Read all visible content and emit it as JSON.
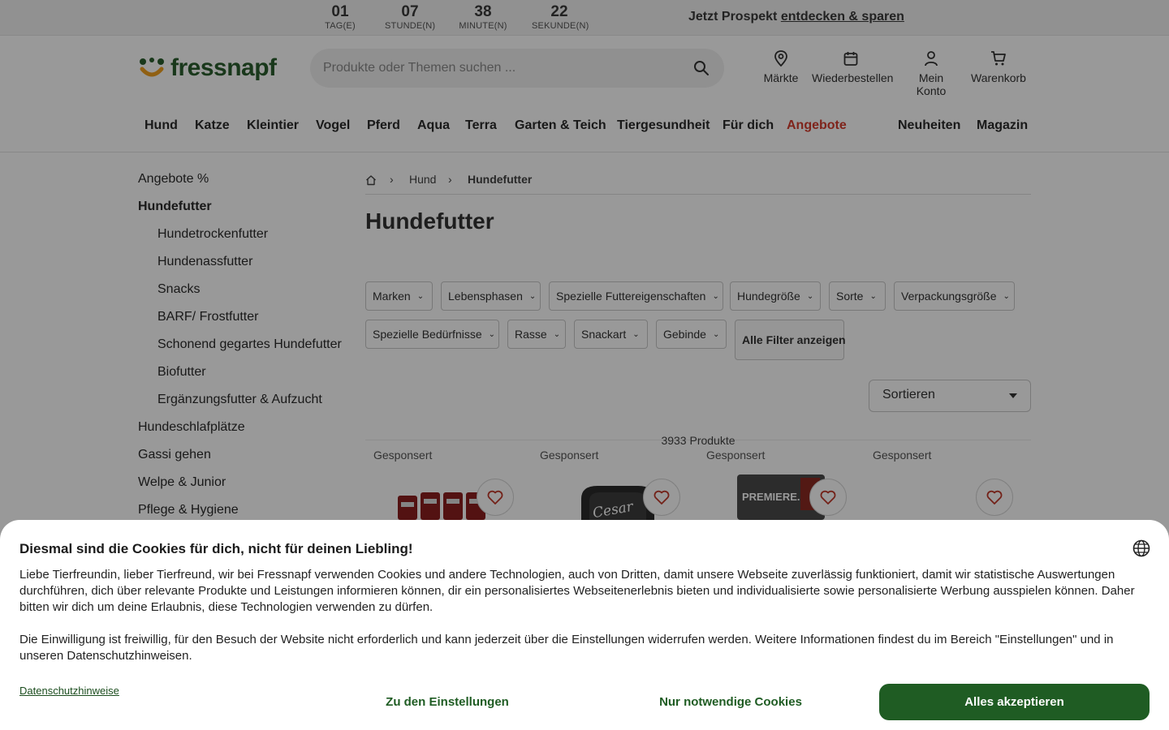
{
  "countdown": [
    {
      "value": "01",
      "label": "TAG(E)"
    },
    {
      "value": "07",
      "label": "STUNDE(N)"
    },
    {
      "value": "38",
      "label": "MINUTE(N)"
    },
    {
      "value": "22",
      "label": "SEKUNDE(N)"
    }
  ],
  "promo": {
    "text": "Jetzt Prospekt",
    "link": "entdecken & sparen"
  },
  "header": {
    "logo": "fressnapf",
    "search_placeholder": "Produkte oder Themen suchen ...",
    "icons": [
      {
        "label": "Märkte",
        "icon": "location-pin-icon"
      },
      {
        "label": "Wiederbestellen",
        "icon": "calendar-icon"
      },
      {
        "label": "Mein Konto",
        "icon": "user-icon"
      },
      {
        "label": "Warenkorb",
        "icon": "cart-icon"
      }
    ]
  },
  "nav": {
    "items": [
      "Hund",
      "Katze",
      "Kleintier",
      "Vogel",
      "Pferd",
      "Aqua",
      "Terra",
      "Garten & Teich",
      "Tiergesundheit",
      "Für dich",
      "Angebote"
    ],
    "right": [
      "Neuheiten",
      "Magazin"
    ],
    "sale_color": "#d43c2d"
  },
  "sidebar": {
    "items": [
      {
        "label": "Angebote %"
      },
      {
        "label": "Hundefutter"
      },
      {
        "label": "Hundetrockenfutter"
      },
      {
        "label": "Hundenassfutter"
      },
      {
        "label": "Snacks"
      },
      {
        "label": "BARF/ Frostfutter"
      },
      {
        "label": "Schonend gegartes Hundefutter"
      },
      {
        "label": "Biofutter"
      },
      {
        "label": "Ergänzungsfutter & Aufzucht"
      },
      {
        "label": "Hundeschlafplätze"
      },
      {
        "label": "Gassi gehen"
      },
      {
        "label": "Welpe & Junior"
      },
      {
        "label": "Pflege & Hygiene"
      }
    ]
  },
  "breadcrumb": [
    "Hund",
    "Hundefutter"
  ],
  "page_title": "Hundefutter",
  "filters": {
    "row1": [
      "Marken",
      "Lebensphasen",
      "Spezielle Futtereigenschaften",
      "Hundegröße",
      "Sorte",
      "Verpackungsgröße"
    ],
    "row2": [
      "Spezielle Bedürfnisse",
      "Rasse",
      "Snackart",
      "Gebinde"
    ],
    "all": "Alle Filter anzeigen"
  },
  "sort_label": "Sortieren",
  "product_count": "3933 Produkte",
  "products": [
    {
      "tag": "Gesponsert"
    },
    {
      "tag": "Gesponsert",
      "brand": "Cesar"
    },
    {
      "tag": "Gesponsert",
      "brand": "PREMIERE."
    },
    {
      "tag": "Gesponsert"
    }
  ],
  "cookie": {
    "title": "Diesmal sind die Cookies für dich, nicht für deinen Liebling!",
    "p1": "Liebe Tierfreundin, lieber Tierfreund, wir bei Fressnapf verwenden Cookies und andere Technologien, auch von Dritten, damit unsere Webseite zuverlässig funktioniert, damit wir statistische Auswertungen durchführen, dich über relevante Produkte und Leistungen informieren können, dir ein personalisiertes Webseitenerlebnis bieten und individualisierte sowie personalisierte Werbung ausspielen können. Daher bitten wir dich um deine Erlaubnis, diese Technologien verwenden zu dürfen.",
    "p2": "Die Einwilligung ist freiwillig, für den Besuch der Website nicht erforderlich und kann jederzeit über die Einstellungen widerrufen werden. Weitere Informationen findest du im Bereich \"Einstellungen\" und in unseren Datenschutzhinweisen.",
    "privacy_link": "Datenschutzhinweise",
    "btn_settings": "Zu den Einstellungen",
    "btn_necessary": "Nur notwendige Cookies",
    "btn_accept": "Alles akzeptieren",
    "accent": "#1f5c23"
  }
}
